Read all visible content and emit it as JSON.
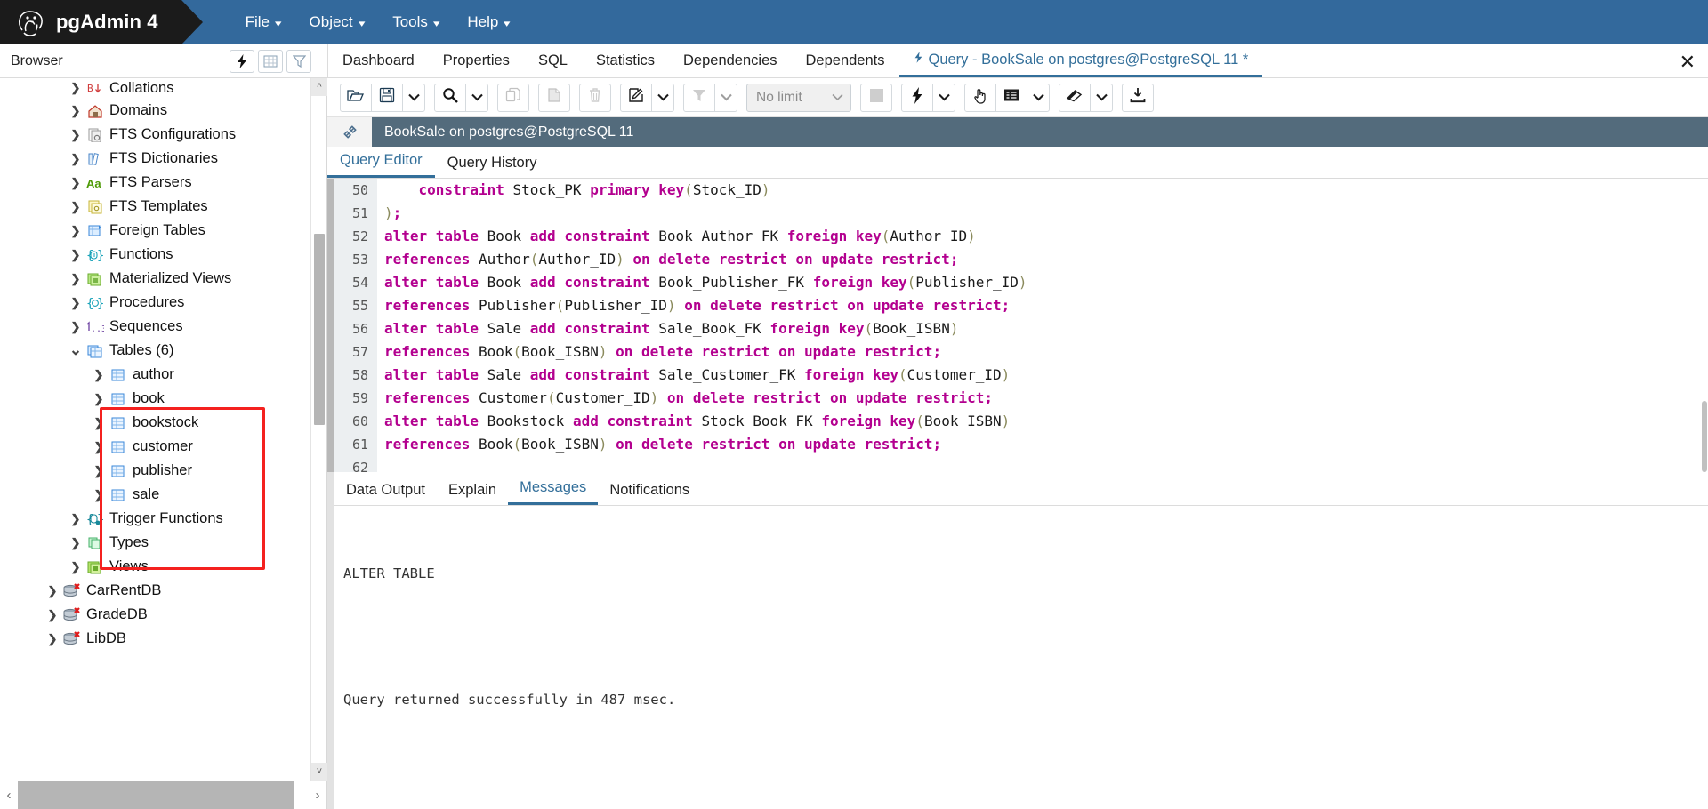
{
  "app": {
    "title": "pgAdmin 4",
    "logo_icon": "elephant-logo"
  },
  "menubar": [
    {
      "label": "File",
      "icon": "chevron-down-icon"
    },
    {
      "label": "Object",
      "icon": "chevron-down-icon"
    },
    {
      "label": "Tools",
      "icon": "chevron-down-icon"
    },
    {
      "label": "Help",
      "icon": "chevron-down-icon"
    }
  ],
  "browser": {
    "label": "Browser",
    "tools": [
      {
        "name": "quick-search-icon",
        "icon": "lightning-icon"
      },
      {
        "name": "object-grid-icon",
        "icon": "grid-icon"
      },
      {
        "name": "filter-icon",
        "icon": "funnel-icon"
      }
    ]
  },
  "object_tabs": [
    {
      "label": "Dashboard",
      "active": false
    },
    {
      "label": "Properties",
      "active": false
    },
    {
      "label": "SQL",
      "active": false
    },
    {
      "label": "Statistics",
      "active": false
    },
    {
      "label": "Dependencies",
      "active": false
    },
    {
      "label": "Dependents",
      "active": false
    },
    {
      "label": "Query - BookSale on postgres@PostgreSQL 11 *",
      "active": true,
      "icon": "lightning-icon"
    }
  ],
  "close_tab_label": "✕",
  "tree": [
    {
      "label": "Collations",
      "icon": "collation-icon",
      "indent": 1,
      "expanded": false,
      "clipped": true
    },
    {
      "label": "Domains",
      "icon": "domain-icon",
      "indent": 1,
      "expanded": false
    },
    {
      "label": "FTS Configurations",
      "icon": "fts-config-icon",
      "indent": 1,
      "expanded": false
    },
    {
      "label": "FTS Dictionaries",
      "icon": "fts-dictionary-icon",
      "indent": 1,
      "expanded": false
    },
    {
      "label": "FTS Parsers",
      "icon": "fts-parser-icon",
      "indent": 1,
      "expanded": false
    },
    {
      "label": "FTS Templates",
      "icon": "fts-template-icon",
      "indent": 1,
      "expanded": false
    },
    {
      "label": "Foreign Tables",
      "icon": "foreign-table-icon",
      "indent": 1,
      "expanded": false
    },
    {
      "label": "Functions",
      "icon": "function-icon",
      "indent": 1,
      "expanded": false
    },
    {
      "label": "Materialized Views",
      "icon": "materialized-view-icon",
      "indent": 1,
      "expanded": false
    },
    {
      "label": "Procedures",
      "icon": "procedure-icon",
      "indent": 1,
      "expanded": false
    },
    {
      "label": "Sequences",
      "icon": "sequence-icon",
      "indent": 1,
      "expanded": false
    },
    {
      "label": "Tables (6)",
      "icon": "tables-icon",
      "indent": 1,
      "expanded": true
    },
    {
      "label": "author",
      "icon": "table-icon",
      "indent": 2,
      "expanded": false
    },
    {
      "label": "book",
      "icon": "table-icon",
      "indent": 2,
      "expanded": false
    },
    {
      "label": "bookstock",
      "icon": "table-icon",
      "indent": 2,
      "expanded": false
    },
    {
      "label": "customer",
      "icon": "table-icon",
      "indent": 2,
      "expanded": false
    },
    {
      "label": "publisher",
      "icon": "table-icon",
      "indent": 2,
      "expanded": false
    },
    {
      "label": "sale",
      "icon": "table-icon",
      "indent": 2,
      "expanded": false
    },
    {
      "label": "Trigger Functions",
      "icon": "trigger-function-icon",
      "indent": 1,
      "expanded": false
    },
    {
      "label": "Types",
      "icon": "type-icon",
      "indent": 1,
      "expanded": false
    },
    {
      "label": "Views",
      "icon": "view-icon",
      "indent": 1,
      "expanded": false
    },
    {
      "label": "CarRentDB",
      "icon": "database-disconnected-icon",
      "indent": 0,
      "expanded": false
    },
    {
      "label": "GradeDB",
      "icon": "database-disconnected-icon",
      "indent": 0,
      "expanded": false
    },
    {
      "label": "LibDB",
      "icon": "database-disconnected-icon",
      "indent": 0,
      "expanded": false
    }
  ],
  "query_toolbar": {
    "buttons": [
      {
        "name": "open-file-button",
        "icon": "folder-open-icon",
        "disabled": false
      },
      {
        "name": "save-file-button",
        "icon": "floppy-disk-icon",
        "disabled": false
      },
      {
        "name": "save-options-dropdown",
        "icon": "chevron-down-icon",
        "disabled": false
      },
      {
        "name": "find-button",
        "icon": "magnifier-icon",
        "disabled": false
      },
      {
        "name": "find-options-dropdown",
        "icon": "chevron-down-icon",
        "disabled": false
      },
      {
        "name": "copy-button",
        "icon": "copy-icon",
        "disabled": true
      },
      {
        "name": "paste-button",
        "icon": "paste-icon",
        "disabled": true
      },
      {
        "name": "delete-button",
        "icon": "trash-icon",
        "disabled": true
      },
      {
        "name": "edit-button",
        "icon": "pencil-square-icon",
        "disabled": false
      },
      {
        "name": "edit-dropdown",
        "icon": "chevron-down-icon",
        "disabled": false
      },
      {
        "name": "filter-button",
        "icon": "funnel-icon",
        "disabled": true
      },
      {
        "name": "filter-dropdown",
        "icon": "chevron-down-icon",
        "disabled": true
      },
      {
        "name": "stop-button",
        "icon": "stop-square-icon",
        "disabled": true
      },
      {
        "name": "execute-button",
        "icon": "lightning-icon",
        "disabled": false
      },
      {
        "name": "execute-dropdown",
        "icon": "chevron-down-icon",
        "disabled": false
      },
      {
        "name": "explain-button",
        "icon": "hand-pointer-icon",
        "disabled": false
      },
      {
        "name": "explain-analyze-button",
        "icon": "list-panel-icon",
        "disabled": false
      },
      {
        "name": "explain-dropdown",
        "icon": "chevron-down-icon",
        "disabled": false
      },
      {
        "name": "clear-button",
        "icon": "eraser-icon",
        "disabled": false
      },
      {
        "name": "clear-dropdown",
        "icon": "chevron-down-icon",
        "disabled": false
      },
      {
        "name": "download-button",
        "icon": "download-icon",
        "disabled": false
      }
    ],
    "row_limit": {
      "value": "No limit",
      "icon": "chevron-down-icon"
    }
  },
  "connection_bar": {
    "icon": "plug-icon",
    "text": "BookSale on postgres@PostgreSQL 11"
  },
  "editor_tabs": [
    {
      "label": "Query Editor",
      "active": true
    },
    {
      "label": "Query History",
      "active": false
    }
  ],
  "code": {
    "first_line": 50,
    "lines": [
      [
        [
          "plain",
          "    "
        ],
        [
          "kw",
          "constraint"
        ],
        [
          "plain",
          " "
        ],
        [
          "id",
          "Stock_PK"
        ],
        [
          "plain",
          " "
        ],
        [
          "kw",
          "primary key"
        ],
        [
          "paren",
          "("
        ],
        [
          "id",
          "Stock_ID"
        ],
        [
          "paren",
          ")"
        ]
      ],
      [
        [
          "paren",
          ")"
        ],
        [
          "kw",
          ";"
        ]
      ],
      [
        [
          "kw",
          "alter table"
        ],
        [
          "plain",
          " "
        ],
        [
          "id",
          "Book"
        ],
        [
          "plain",
          " "
        ],
        [
          "kw",
          "add constraint"
        ],
        [
          "plain",
          " "
        ],
        [
          "id",
          "Book_Author_FK"
        ],
        [
          "plain",
          " "
        ],
        [
          "kw",
          "foreign key"
        ],
        [
          "paren",
          "("
        ],
        [
          "id",
          "Author_ID"
        ],
        [
          "paren",
          ")"
        ]
      ],
      [
        [
          "kw",
          "references"
        ],
        [
          "plain",
          " "
        ],
        [
          "id",
          "Author"
        ],
        [
          "paren",
          "("
        ],
        [
          "id",
          "Author_ID"
        ],
        [
          "paren",
          ")"
        ],
        [
          "plain",
          " "
        ],
        [
          "kw",
          "on delete restrict on update restrict"
        ],
        [
          "kw",
          ";"
        ]
      ],
      [
        [
          "kw",
          "alter table"
        ],
        [
          "plain",
          " "
        ],
        [
          "id",
          "Book"
        ],
        [
          "plain",
          " "
        ],
        [
          "kw",
          "add constraint"
        ],
        [
          "plain",
          " "
        ],
        [
          "id",
          "Book_Publisher_FK"
        ],
        [
          "plain",
          " "
        ],
        [
          "kw",
          "foreign key"
        ],
        [
          "paren",
          "("
        ],
        [
          "id",
          "Publisher_ID"
        ],
        [
          "paren",
          ")"
        ]
      ],
      [
        [
          "kw",
          "references"
        ],
        [
          "plain",
          " "
        ],
        [
          "id",
          "Publisher"
        ],
        [
          "paren",
          "("
        ],
        [
          "id",
          "Publisher_ID"
        ],
        [
          "paren",
          ")"
        ],
        [
          "plain",
          " "
        ],
        [
          "kw",
          "on delete restrict on update restrict"
        ],
        [
          "kw",
          ";"
        ]
      ],
      [
        [
          "kw",
          "alter table"
        ],
        [
          "plain",
          " "
        ],
        [
          "id",
          "Sale"
        ],
        [
          "plain",
          " "
        ],
        [
          "kw",
          "add constraint"
        ],
        [
          "plain",
          " "
        ],
        [
          "id",
          "Sale_Book_FK"
        ],
        [
          "plain",
          " "
        ],
        [
          "kw",
          "foreign key"
        ],
        [
          "paren",
          "("
        ],
        [
          "id",
          "Book_ISBN"
        ],
        [
          "paren",
          ")"
        ]
      ],
      [
        [
          "kw",
          "references"
        ],
        [
          "plain",
          " "
        ],
        [
          "id",
          "Book"
        ],
        [
          "paren",
          "("
        ],
        [
          "id",
          "Book_ISBN"
        ],
        [
          "paren",
          ")"
        ],
        [
          "plain",
          " "
        ],
        [
          "kw",
          "on delete restrict on update restrict"
        ],
        [
          "kw",
          ";"
        ]
      ],
      [
        [
          "kw",
          "alter table"
        ],
        [
          "plain",
          " "
        ],
        [
          "id",
          "Sale"
        ],
        [
          "plain",
          " "
        ],
        [
          "kw",
          "add constraint"
        ],
        [
          "plain",
          " "
        ],
        [
          "id",
          "Sale_Customer_FK"
        ],
        [
          "plain",
          " "
        ],
        [
          "kw",
          "foreign key"
        ],
        [
          "paren",
          "("
        ],
        [
          "id",
          "Customer_ID"
        ],
        [
          "paren",
          ")"
        ]
      ],
      [
        [
          "kw",
          "references"
        ],
        [
          "plain",
          " "
        ],
        [
          "id",
          "Customer"
        ],
        [
          "paren",
          "("
        ],
        [
          "id",
          "Customer_ID"
        ],
        [
          "paren",
          ")"
        ],
        [
          "plain",
          " "
        ],
        [
          "kw",
          "on delete restrict on update restrict"
        ],
        [
          "kw",
          ";"
        ]
      ],
      [
        [
          "kw",
          "alter table"
        ],
        [
          "plain",
          " "
        ],
        [
          "id",
          "Bookstock"
        ],
        [
          "plain",
          " "
        ],
        [
          "kw",
          "add constraint"
        ],
        [
          "plain",
          " "
        ],
        [
          "id",
          "Stock_Book_FK"
        ],
        [
          "plain",
          " "
        ],
        [
          "kw",
          "foreign key"
        ],
        [
          "paren",
          "("
        ],
        [
          "id",
          "Book_ISBN"
        ],
        [
          "paren",
          ")"
        ]
      ],
      [
        [
          "kw",
          "references"
        ],
        [
          "plain",
          " "
        ],
        [
          "id",
          "Book"
        ],
        [
          "paren",
          "("
        ],
        [
          "id",
          "Book_ISBN"
        ],
        [
          "paren",
          ")"
        ],
        [
          "plain",
          " "
        ],
        [
          "kw",
          "on delete restrict on update restrict"
        ],
        [
          "kw",
          ";"
        ]
      ],
      []
    ]
  },
  "output_tabs": [
    {
      "label": "Data Output",
      "active": false
    },
    {
      "label": "Explain",
      "active": false
    },
    {
      "label": "Messages",
      "active": true
    },
    {
      "label": "Notifications",
      "active": false
    }
  ],
  "messages": {
    "line1": "ALTER TABLE",
    "line2": "Query returned successfully in 487 msec."
  },
  "colors": {
    "brand_dark": "#1b1b1b",
    "header_blue": "#33699c",
    "accent_blue": "#336f9a",
    "connection_bar": "#536b7c",
    "highlight_red": "#f4211f",
    "keyword_magenta": "#b3008f"
  }
}
